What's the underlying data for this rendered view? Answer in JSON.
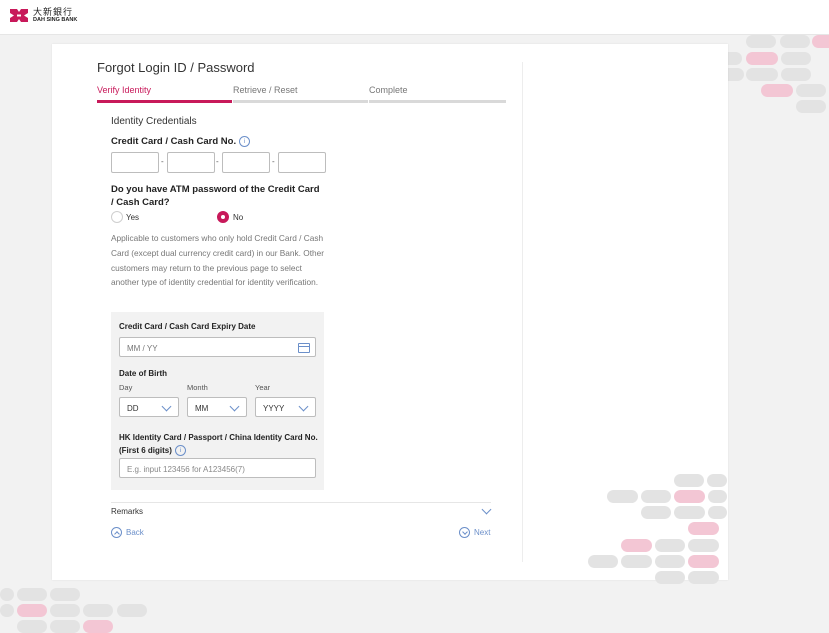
{
  "brand": {
    "name_cn": "大新銀行",
    "name_en": "DAH SING BANK",
    "color": "#c8195a"
  },
  "page_title": "Forgot Login ID / Password",
  "steps": [
    {
      "label": "Verify Identity",
      "active": true
    },
    {
      "label": "Retrieve / Reset",
      "active": false
    },
    {
      "label": "Complete",
      "active": false
    }
  ],
  "section_heading": "Identity Credentials",
  "card_number": {
    "label": "Credit Card / Cash Card No.",
    "info_icon": "info-icon",
    "separator": "-"
  },
  "atm_question": {
    "label": "Do you have ATM password of the Credit Card / Cash Card?",
    "options": [
      {
        "label": "Yes",
        "selected": false
      },
      {
        "label": "No",
        "selected": true
      }
    ]
  },
  "description": "Applicable to customers who only hold Credit Card / Cash Card (except dual currency credit card) in our Bank. Other customers may return to the previous page to select another type of identity credential for identity verification.",
  "expiry": {
    "label": "Credit Card / Cash Card Expiry Date",
    "placeholder": "MM / YY",
    "icon": "calendar-icon"
  },
  "dob": {
    "label": "Date of Birth",
    "day_label": "Day",
    "day_value": "DD",
    "month_label": "Month",
    "month_value": "MM",
    "year_label": "Year",
    "year_value": "YYYY"
  },
  "id_card": {
    "label": "HK Identity Card / Passport / China Identity Card No. (First 6 digits)",
    "placeholder": "E.g. input 123456 for A123456(7)"
  },
  "remarks": "Remarks",
  "back_label": "Back",
  "next_label": "Next",
  "info_glyph": "i"
}
